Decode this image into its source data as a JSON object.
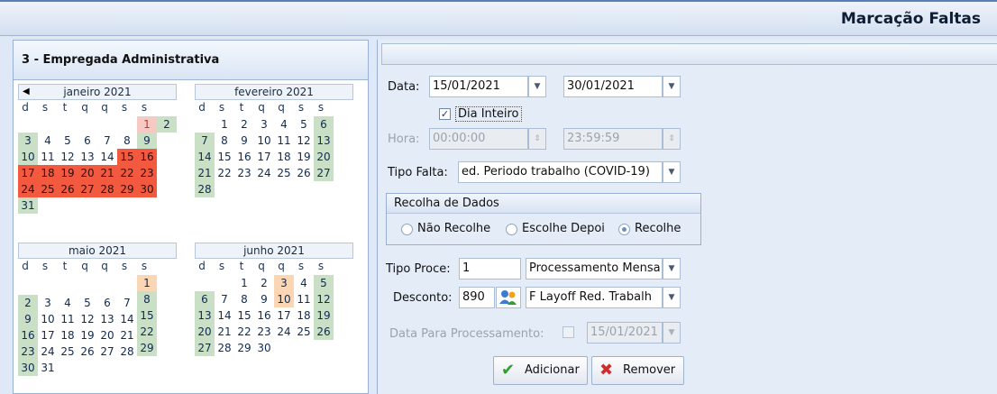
{
  "window": {
    "title": "Marcação Faltas"
  },
  "left": {
    "employee": "3 - Empregada Administrativa",
    "dow": [
      "d",
      "s",
      "t",
      "q",
      "q",
      "s",
      "s"
    ],
    "months": [
      {
        "title": "janeiro 2021"
      },
      {
        "title": "fevereiro 2021"
      },
      {
        "title": "maio 2021"
      },
      {
        "title": "junho 2021"
      }
    ]
  },
  "form": {
    "data_label": "Data:",
    "date_from": "15/01/2021",
    "date_to": "30/01/2021",
    "dia_inteiro_label": "Dia Inteiro",
    "hora_label": "Hora:",
    "hora_from": "00:00:00",
    "hora_to": "23:59:59",
    "tipo_falta_label": "Tipo Falta:",
    "tipo_falta_value": "ed. Periodo trabalho (COVID-19)",
    "recolha_title": "Recolha de Dados",
    "radio_nao": "Não Recolhe",
    "radio_escolhe": "Escolhe Depoi",
    "radio_recolhe": "Recolhe",
    "tipo_proc_label": "Tipo Proce:",
    "tipo_proc_code": "1",
    "tipo_proc_value": "Processamento Mensa",
    "desconto_label": "Desconto:",
    "desconto_code": "890",
    "desconto_value": "F Layoff Red. Trabalh",
    "data_proc_label": "Data Para Processamento:",
    "data_proc_value": "15/01/2021",
    "btn_add": "Adicionar",
    "btn_remove": "Remover"
  }
}
